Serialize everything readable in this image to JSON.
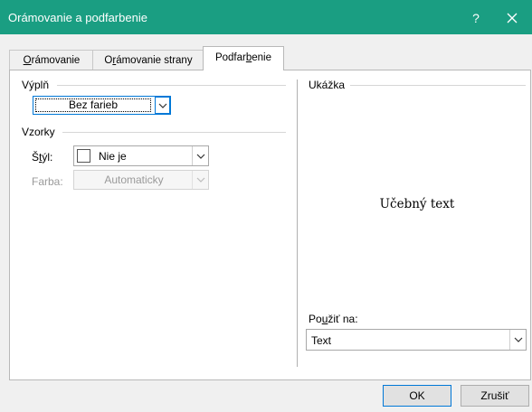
{
  "window": {
    "title": "Orámovanie a podfarbenie",
    "help": "?"
  },
  "tabs": [
    {
      "pre": "",
      "ul": "O",
      "post": "rámovanie"
    },
    {
      "pre": "O",
      "ul": "r",
      "post": "ámovanie strany"
    },
    {
      "pre": "Podfar",
      "ul": "b",
      "post": "enie"
    }
  ],
  "fill": {
    "group_label": "Výplň",
    "color_value": "Bez farieb"
  },
  "patterns": {
    "group_label": "Vzorky",
    "style_label_pre": "Š",
    "style_label_ul": "t",
    "style_label_post": "ýl:",
    "style_value": "Nie je",
    "color_label": "Farba:",
    "color_value": "Automaticky"
  },
  "preview": {
    "group_label": "Ukážka",
    "sample_text": "Učebný text",
    "apply_label_pre": "Po",
    "apply_label_ul": "u",
    "apply_label_post": "žiť na:",
    "apply_value": "Text"
  },
  "buttons": {
    "ok": "OK",
    "cancel": "Zrušiť"
  },
  "colors": {
    "titlebar": "#1a9e82",
    "focus_border": "#0078d7"
  }
}
